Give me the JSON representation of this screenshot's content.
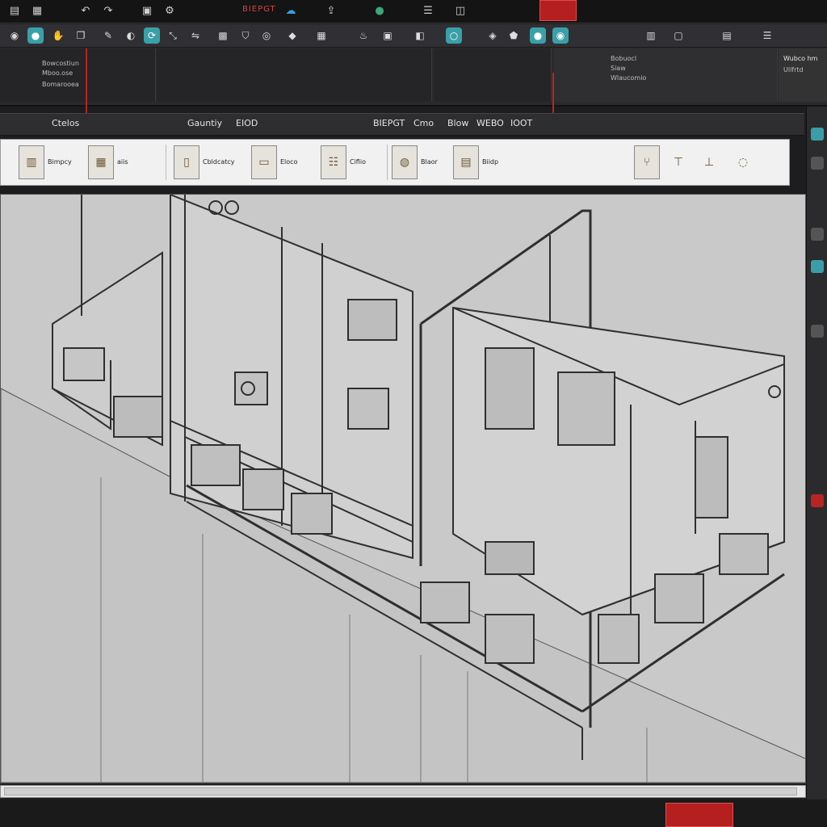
{
  "titlebar": {
    "title": "BIEPGT",
    "icons": [
      "folder-icon",
      "save-icon",
      "undo-icon",
      "redo-icon",
      "print-icon",
      "cloud-icon",
      "settings-icon",
      "share-icon"
    ]
  },
  "ribbon1": {
    "icons": [
      "select-icon",
      "sphere-icon",
      "hand-icon",
      "copy-icon",
      "brush-icon",
      "paint-icon",
      "rotate-icon",
      "scale-icon",
      "mirror-icon",
      "array-icon",
      "shield-icon",
      "view-icon",
      "camera-icon",
      "grid-icon",
      "lamp-icon",
      "cube-icon",
      "gem-icon",
      "circle-icon",
      "shape-icon",
      "tag-icon"
    ],
    "left_panel": [
      "Bowcostiun",
      "Mboo.ose",
      "Bomarooea"
    ],
    "right_panel": [
      "Bobuocl",
      "Siaw",
      "Wlaucomio"
    ],
    "far_right": [
      "Wubco hm",
      "Ullfrtd"
    ]
  },
  "tabs": [
    "Ctelos",
    "Gauntiy",
    "EIOD",
    "BIEPGT",
    "Cmo",
    "Blow",
    "WEBO",
    "IOOT"
  ],
  "palette": {
    "tools": [
      {
        "icon": "cabinet-icon",
        "label": "Bimpcy"
      },
      {
        "icon": "box-icon",
        "label": "aiis"
      },
      {
        "icon": "door-icon",
        "label": "Cbldcatcy"
      },
      {
        "icon": "sofa-icon",
        "label": "Eloco"
      },
      {
        "icon": "shelf-icon",
        "label": "Ciflio"
      },
      {
        "icon": "lamp-icon",
        "label": "Blaor"
      },
      {
        "icon": "window-icon",
        "label": "Biidp"
      },
      {
        "icon": "chair-icon",
        "label": ""
      },
      {
        "icon": "table-icon",
        "label": ""
      },
      {
        "icon": "stool-icon",
        "label": ""
      }
    ]
  },
  "colors": {
    "accent_red": "#b51f1f",
    "panel_dark": "#2a2a2c",
    "viewport_gray": "#c9c9c9",
    "line_dark": "#2f2f2f"
  }
}
